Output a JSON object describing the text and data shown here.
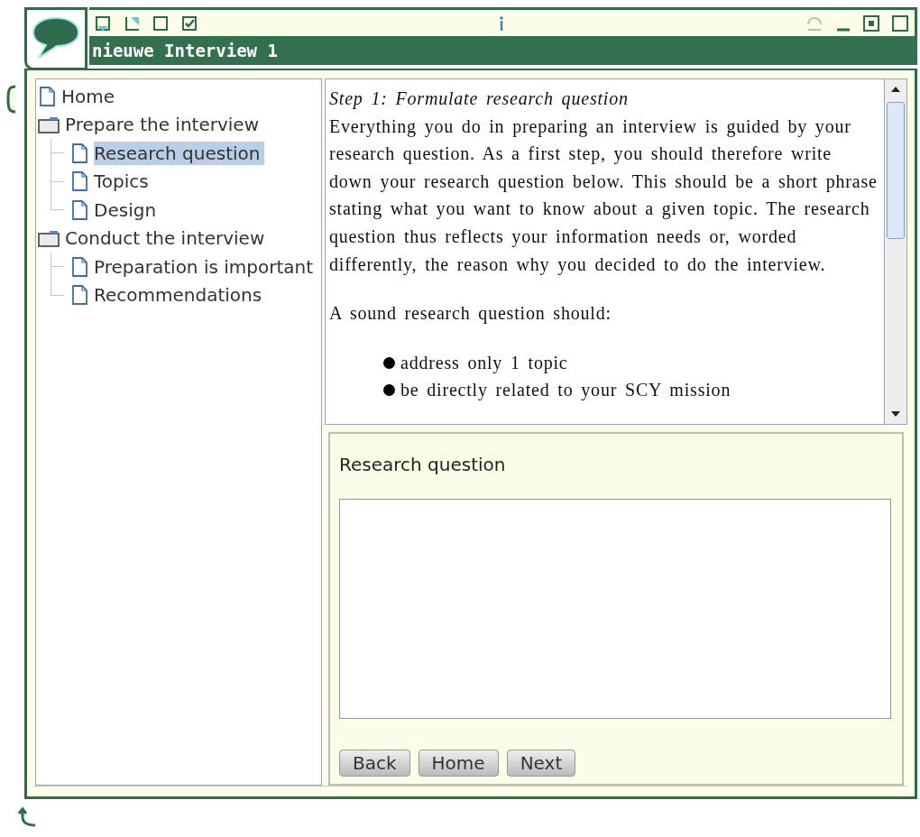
{
  "window": {
    "title": "nieuwe Interview 1",
    "toolbar_checkbox": {
      "checked": true
    }
  },
  "tree": [
    {
      "label": "Home",
      "kind": "page",
      "selected": false
    },
    {
      "label": "Prepare the interview",
      "kind": "folder",
      "selected": false,
      "children": [
        {
          "label": "Research question",
          "kind": "page",
          "selected": true
        },
        {
          "label": "Topics",
          "kind": "page",
          "selected": false
        },
        {
          "label": "Design",
          "kind": "page",
          "selected": false
        }
      ]
    },
    {
      "label": "Conduct the interview",
      "kind": "folder",
      "selected": false,
      "children": [
        {
          "label": "Preparation is important",
          "kind": "page",
          "selected": false
        },
        {
          "label": "Recommendations",
          "kind": "page",
          "selected": false
        }
      ]
    }
  ],
  "content": {
    "heading": "Step 1: Formulate research question",
    "paragraphs": [
      "Everything you do in preparing an interview is guided by your research question. As a first step, you should therefore write down your research question below. This should be a short phrase stating what you want to know about a given topic. The research question thus reflects your information needs or, worded differently, the reason why you decided to do the interview.",
      "A sound research question should:"
    ],
    "bullets": [
      "address only 1 topic",
      "be directly related to your SCY mission"
    ]
  },
  "answer": {
    "label": "Research question"
  },
  "buttons": [
    "Back",
    "Home",
    "Next"
  ]
}
